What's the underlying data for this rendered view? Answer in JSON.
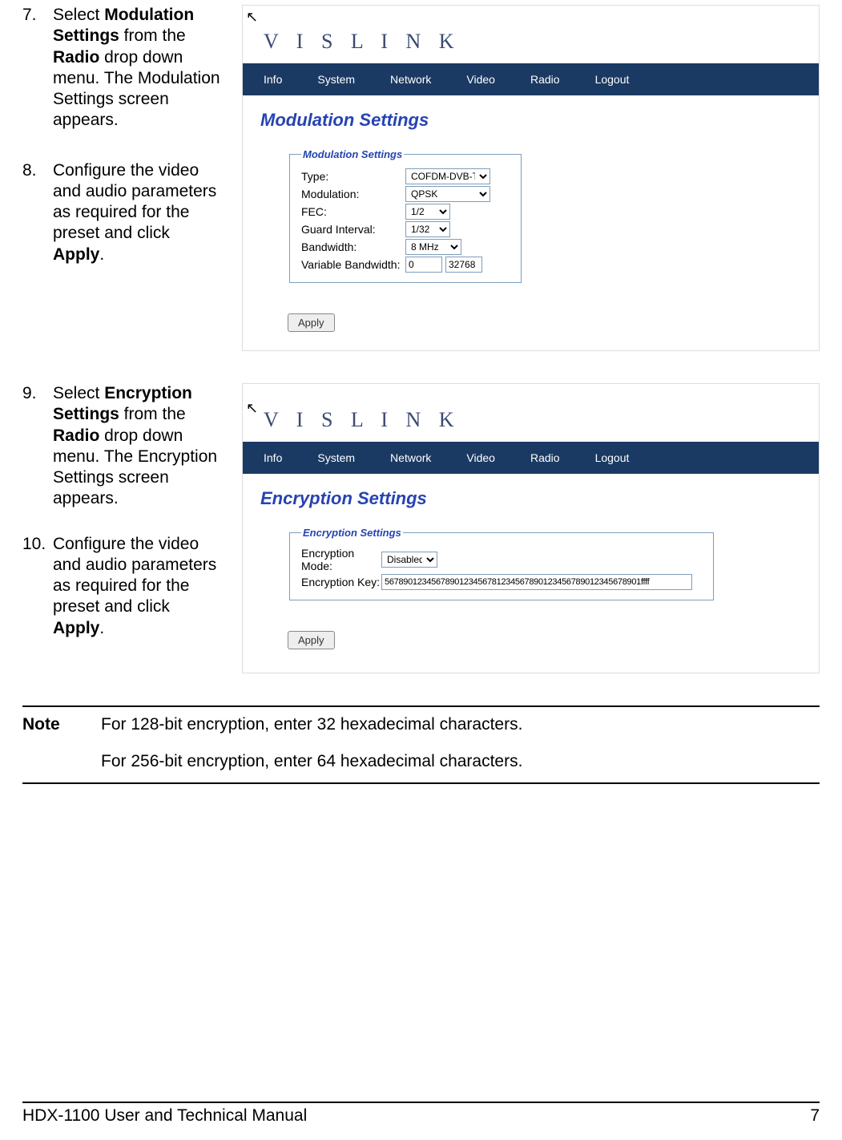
{
  "steps": {
    "s7": {
      "num": "7.",
      "pre": "Select ",
      "b1": "Modulation Settings",
      "mid1": " from the ",
      "b2": "Radio",
      "post": " drop down menu. The Modulation Settings screen appears."
    },
    "s8": {
      "num": "8.",
      "pre": "Configure the video and audio parameters as required for the preset and click ",
      "b1": "Apply",
      "post": "."
    },
    "s9": {
      "num": "9.",
      "pre": "Select ",
      "b1": "Encryption Settings",
      "mid1": " from the ",
      "b2": "Radio",
      "post": " drop down menu. The Encryption Settings screen appears."
    },
    "s10": {
      "num": "10.",
      "pre": "Configure the video and audio parameters as required for the preset and click ",
      "b1": "Apply",
      "post": "."
    }
  },
  "brand": "V I S L I N K",
  "nav": {
    "info": "Info",
    "system": "System",
    "network": "Network",
    "video": "Video",
    "radio": "Radio",
    "logout": "Logout"
  },
  "mod": {
    "title": "Modulation Settings",
    "legend": "Modulation Settings",
    "labels": {
      "type": "Type:",
      "modulation": "Modulation:",
      "fec": "FEC:",
      "guard": "Guard Interval:",
      "bw": "Bandwidth:",
      "vbw": "Variable Bandwidth:"
    },
    "values": {
      "type": "COFDM-DVB-T",
      "modulation": "QPSK",
      "fec": "1/2",
      "guard": "1/32",
      "bw": "8 MHz",
      "vbw1": "0",
      "vbw2": "32768"
    },
    "apply": "Apply"
  },
  "enc": {
    "title": "Encryption Settings",
    "legend": "Encryption Settings",
    "labels": {
      "mode": "Encryption Mode:",
      "key": "Encryption Key:"
    },
    "values": {
      "mode": "Disabled",
      "key": "5678901234567890123456781234567890123456789012345678901ffff"
    },
    "apply": "Apply"
  },
  "note": {
    "label": "Note",
    "line1": "For 128-bit encryption, enter 32 hexadecimal characters.",
    "line2": "For 256-bit encryption, enter 64 hexadecimal characters."
  },
  "footer": {
    "title": "HDX-1100 User and Technical Manual",
    "page": "7"
  }
}
